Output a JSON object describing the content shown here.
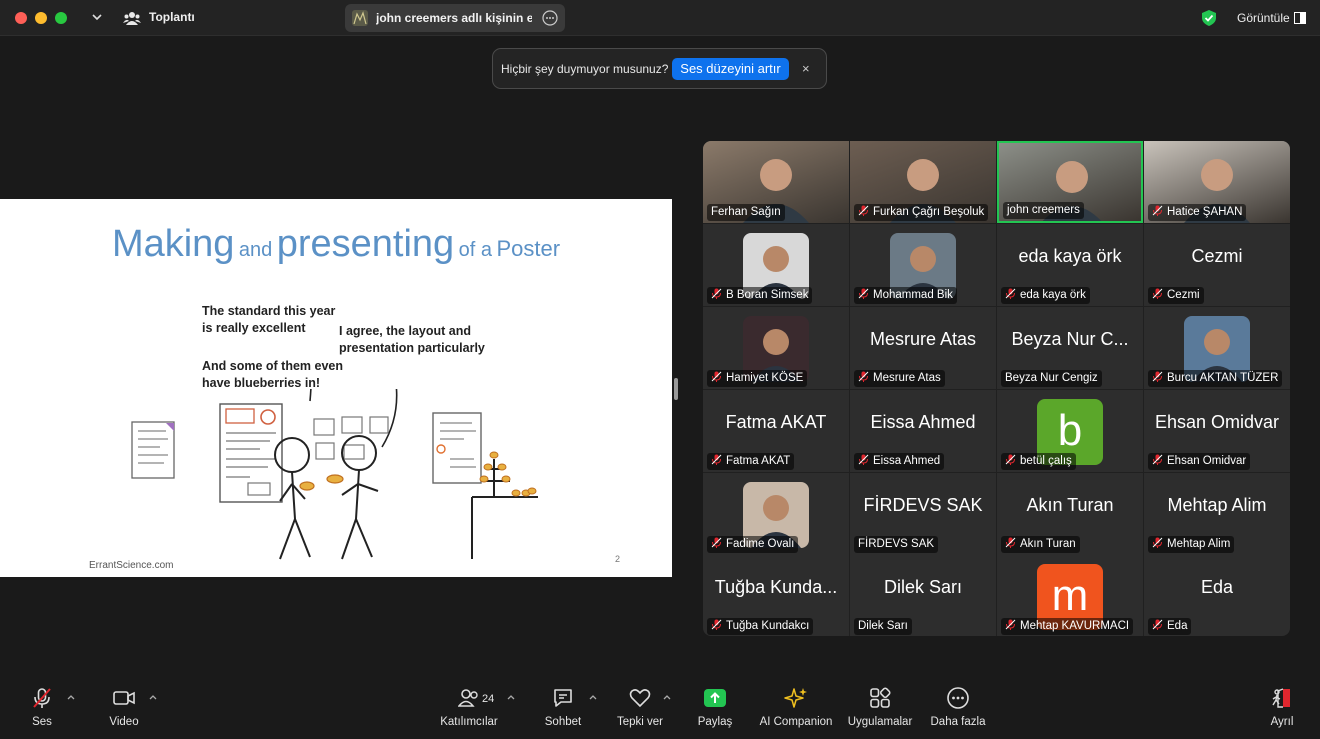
{
  "titlebar": {
    "meeting_title": "Toplantı",
    "share_indicator": "john creemers adlı kişinin ekran",
    "view_label": "Görüntüle"
  },
  "toast": {
    "message": "Hiçbir şey duymuyor musunuz?",
    "action_label": "Ses düzeyini artır",
    "close_label": "×"
  },
  "slide": {
    "title_making": "Making",
    "title_and": "and",
    "title_presenting": "presenting",
    "title_of_a": "of a",
    "title_poster": "Poster",
    "bubble_1_line_1": "The standard this year",
    "bubble_1_line_2": "is really excellent",
    "bubble_2_line_1": "I agree, the layout and",
    "bubble_2_line_2": "presentation particularly",
    "bubble_3_line_1": "And some of them even",
    "bubble_3_line_2": "have blueberries in!",
    "footer": "ErrantScience.com",
    "page_number": "2"
  },
  "participants": [
    {
      "name": "Ferhan Sağın",
      "big": "",
      "muted": false,
      "kind": "video",
      "tone": "#8b7a6a"
    },
    {
      "name": "Furkan Çağrı Beşoluk",
      "big": "",
      "muted": true,
      "kind": "video",
      "tone": "#6d5e52"
    },
    {
      "name": "john creemers",
      "big": "",
      "muted": false,
      "kind": "video",
      "tone": "#8c8f88",
      "speaking": true
    },
    {
      "name": "Hatice ŞAHAN",
      "big": "",
      "muted": true,
      "kind": "video",
      "tone": "#c9c3bb"
    },
    {
      "name": "B Boran Simsek",
      "big": "",
      "muted": true,
      "kind": "photo",
      "tone": "#d8d8d8"
    },
    {
      "name": "Mohammad Bik",
      "big": "",
      "muted": true,
      "kind": "photo",
      "tone": "#6b7a86"
    },
    {
      "name": "eda kaya örk",
      "big": "eda kaya örk",
      "muted": true,
      "kind": "text"
    },
    {
      "name": "Cezmi",
      "big": "Cezmi",
      "muted": true,
      "kind": "text"
    },
    {
      "name": "Hamiyet KÖSE",
      "big": "",
      "muted": true,
      "kind": "photo",
      "tone": "#3a2a2e"
    },
    {
      "name": "Mesrure Atas",
      "big": "Mesrure Atas",
      "muted": true,
      "kind": "text"
    },
    {
      "name": "Beyza Nur Cengiz",
      "big": "Beyza Nur C...",
      "muted": false,
      "kind": "text"
    },
    {
      "name": "Burcu AKTAN TÜZER",
      "big": "",
      "muted": true,
      "kind": "photo",
      "tone": "#5a7a9a"
    },
    {
      "name": "Fatma AKAT",
      "big": "Fatma AKAT",
      "muted": true,
      "kind": "text"
    },
    {
      "name": "Eissa Ahmed",
      "big": "Eissa Ahmed",
      "muted": true,
      "kind": "text"
    },
    {
      "name": "betül çalış",
      "big": "",
      "muted": true,
      "kind": "letter",
      "letter": "b",
      "color": "#5ba72a"
    },
    {
      "name": "Ehsan Omidvar",
      "big": "Ehsan Omidvar",
      "muted": true,
      "kind": "text"
    },
    {
      "name": "Fadime Ovalı",
      "big": "",
      "muted": true,
      "kind": "photo",
      "tone": "#c8b8a8"
    },
    {
      "name": "FİRDEVS SAK",
      "big": "FİRDEVS SAK",
      "muted": false,
      "kind": "text"
    },
    {
      "name": "Akın Turan",
      "big": "Akın Turan",
      "muted": true,
      "kind": "text"
    },
    {
      "name": "Mehtap Alim",
      "big": "Mehtap Alim",
      "muted": true,
      "kind": "text"
    },
    {
      "name": "Tuğba Kundakcı",
      "big": "Tuğba Kunda...",
      "muted": true,
      "kind": "text"
    },
    {
      "name": "Dilek Sarı",
      "big": "Dilek Sarı",
      "muted": false,
      "kind": "text"
    },
    {
      "name": "Mehtap KAVURMACI",
      "big": "",
      "muted": true,
      "kind": "letter",
      "letter": "m",
      "color": "#f0541e"
    },
    {
      "name": "Eda",
      "big": "Eda",
      "muted": true,
      "kind": "text"
    }
  ],
  "toolbar": {
    "audio_label": "Ses",
    "video_label": "Video",
    "participants_label": "Katılımcılar",
    "participants_count": "24",
    "chat_label": "Sohbet",
    "react_label": "Tepki ver",
    "share_label": "Paylaş",
    "ai_label": "AI Companion",
    "apps_label": "Uygulamalar",
    "more_label": "Daha fazla",
    "leave_label": "Ayrıl"
  },
  "colors": {
    "accent_blue": "#0e72ed",
    "share_green": "#23c552",
    "mute_red": "#e0262e",
    "slide_title_blue": "#5b91c6"
  }
}
